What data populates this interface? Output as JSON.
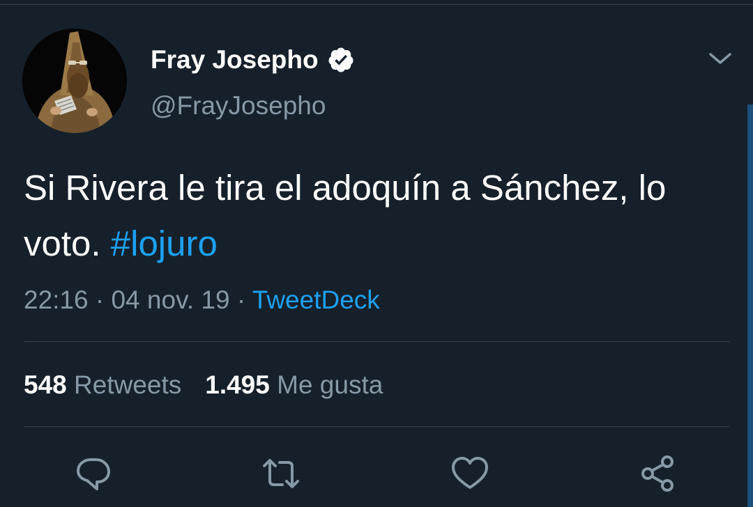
{
  "tweet": {
    "display_name": "Fray Josepho",
    "handle": "@FrayJosepho",
    "text": "Si Rivera le tira el adoquín a Sánchez, lo voto.",
    "hashtag": "#lojuro",
    "time": "22:16",
    "date": "04 nov. 19",
    "separator": "·",
    "source": "TweetDeck",
    "retweets_count": "548",
    "retweets_label": "Retweets",
    "likes_count": "1.495",
    "likes_label": "Me gusta"
  },
  "icons": {
    "verified": "verified-badge-icon",
    "menu": "chevron-down-icon",
    "reply": "reply-icon",
    "retweet": "retweet-icon",
    "like": "heart-icon",
    "share": "share-icon"
  },
  "colors": {
    "background": "#15202b",
    "text_primary": "#ffffff",
    "text_secondary": "#8899a6",
    "accent": "#1da1f2",
    "divider": "#38444d"
  }
}
